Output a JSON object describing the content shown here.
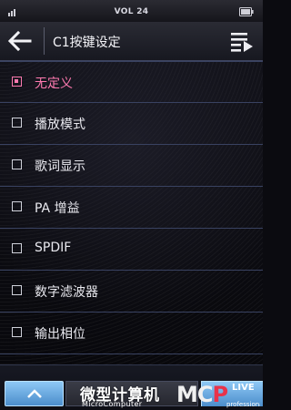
{
  "status_bar": {
    "title": "VOL 24",
    "signal_icon": "signal-icon",
    "battery_icon": "battery-icon"
  },
  "header": {
    "back_icon": "back-arrow-icon",
    "title": "C1按键设定",
    "menu_icon": "list-menu-icon"
  },
  "options": [
    {
      "label": "无定义",
      "checked": true
    },
    {
      "label": "播放模式",
      "checked": false
    },
    {
      "label": "歌词显示",
      "checked": false
    },
    {
      "label": "PA 增益",
      "checked": false
    },
    {
      "label": "SPDIF",
      "checked": false
    },
    {
      "label": "数字滤波器",
      "checked": false
    },
    {
      "label": "输出相位",
      "checked": false
    }
  ],
  "bottom_bar": {
    "up_icon": "chevron-up-icon"
  },
  "watermark": {
    "cn": "微型计算机",
    "en": "MicroComputer",
    "logo_mc": "MC",
    "logo_p": "P",
    "logo_live": "LIVE",
    "logo_pro": "professional"
  },
  "colors": {
    "accent": "#ff7ab0",
    "button_blue": "#6fb0e8",
    "divider": "#394261"
  }
}
